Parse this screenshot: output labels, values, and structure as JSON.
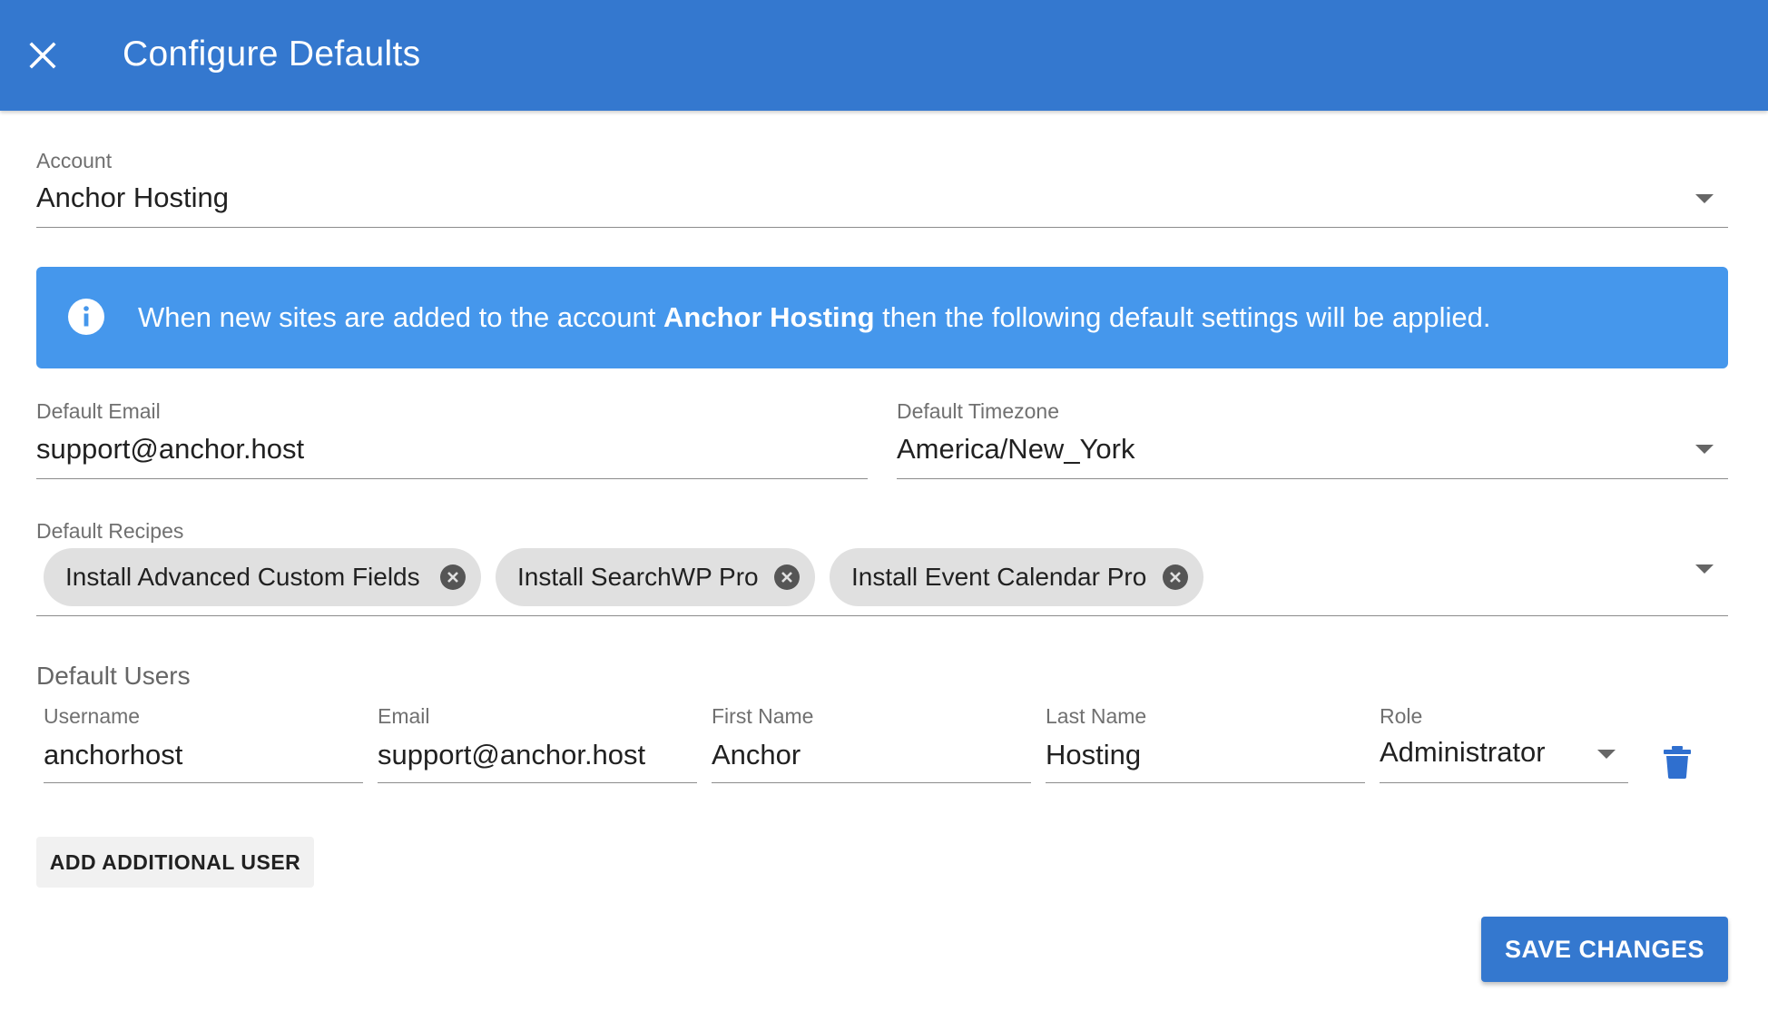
{
  "window": {
    "title": "Configure Defaults"
  },
  "account": {
    "label": "Account",
    "value": "Anchor Hosting"
  },
  "alert": {
    "text_before": "When new sites are added to the account ",
    "account_name": "Anchor Hosting",
    "text_after": " then the following default settings will be applied."
  },
  "default_email": {
    "label": "Default Email",
    "value": "support@anchor.host"
  },
  "default_timezone": {
    "label": "Default Timezone",
    "value": "America/New_York"
  },
  "default_recipes": {
    "label": "Default Recipes",
    "chips": [
      "Install Advanced Custom Fields",
      "Install SearchWP Pro",
      "Install Event Calendar Pro"
    ]
  },
  "default_users": {
    "title": "Default Users",
    "columns": {
      "username": "Username",
      "email": "Email",
      "first_name": "First Name",
      "last_name": "Last Name",
      "role": "Role"
    },
    "users": [
      {
        "username": "anchorhost",
        "email": "support@anchor.host",
        "first_name": "Anchor",
        "last_name": "Hosting",
        "role": "Administrator"
      }
    ]
  },
  "buttons": {
    "add_user": "ADD ADDITIONAL USER",
    "save": "SAVE CHANGES"
  },
  "colors": {
    "toolbar": "#3478cf",
    "alert": "#4597ec",
    "primary_button": "#3478cf",
    "chip": "#e0e0e0"
  },
  "icons": {
    "close": "close-icon",
    "info": "info-icon",
    "chip_remove": "cancel-circle-icon",
    "dropdown": "caret-down-icon",
    "delete": "trash-icon"
  }
}
